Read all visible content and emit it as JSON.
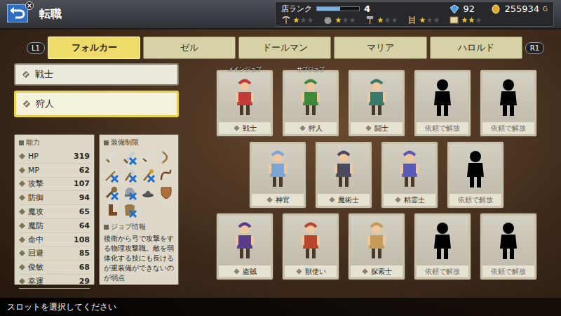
{
  "header": {
    "title": "転職",
    "shop_rank_label": "店ランク",
    "shop_rank": "4",
    "rank_level": 0.55,
    "gems": "92",
    "gold": "255934",
    "gold_unit": "G",
    "max_stars": 3,
    "crafts": [
      {
        "kind": "pickaxe",
        "stars": 1
      },
      {
        "kind": "pot",
        "stars": 1
      },
      {
        "kind": "hammer",
        "stars": 1
      },
      {
        "kind": "ladder",
        "stars": 1
      },
      {
        "kind": "map",
        "stars": 2
      }
    ]
  },
  "shoulder_left": "L1",
  "shoulder_right": "R1",
  "tabs": [
    {
      "label": "フォルカー",
      "selected": true
    },
    {
      "label": "ゼル",
      "selected": false
    },
    {
      "label": "ドールマン",
      "selected": false
    },
    {
      "label": "マリア",
      "selected": false
    },
    {
      "label": "ハロルド",
      "selected": false
    }
  ],
  "slots": [
    {
      "label": "戦士",
      "selected": false
    },
    {
      "label": "狩人",
      "selected": true
    }
  ],
  "stats": {
    "title": "能力",
    "rows": [
      {
        "label": "HP",
        "value": "319"
      },
      {
        "label": "MP",
        "value": "62"
      },
      {
        "label": "攻撃",
        "value": "107"
      },
      {
        "label": "防御",
        "value": "94"
      },
      {
        "label": "魔攻",
        "value": "65"
      },
      {
        "label": "魔防",
        "value": "64"
      },
      {
        "label": "命中",
        "value": "108"
      },
      {
        "label": "回避",
        "value": "85"
      },
      {
        "label": "俊敏",
        "value": "68"
      },
      {
        "label": "幸運",
        "value": "29"
      }
    ]
  },
  "equipment": {
    "title": "装備制限",
    "items": [
      {
        "kind": "sword",
        "restricted": false
      },
      {
        "kind": "greatsword",
        "restricted": true
      },
      {
        "kind": "dagger",
        "restricted": false
      },
      {
        "kind": "bow",
        "restricted": false
      },
      {
        "kind": "spear",
        "restricted": true
      },
      {
        "kind": "axe",
        "restricted": true
      },
      {
        "kind": "staff",
        "restricted": true
      },
      {
        "kind": "whip",
        "restricted": false
      },
      {
        "kind": "club",
        "restricted": true
      },
      {
        "kind": "helmet",
        "restricted": true
      },
      {
        "kind": "hat",
        "restricted": false
      },
      {
        "kind": "shield",
        "restricted": false
      },
      {
        "kind": "boots",
        "restricted": false
      },
      {
        "kind": "armor",
        "restricted": true
      }
    ]
  },
  "job_info": {
    "title": "ジョブ情報",
    "text": "後衛から弓で攻撃をする物理攻撃職。敵を弱体化する技にも長けるが重装備ができないのが弱点"
  },
  "job_rows": [
    {
      "cards": [
        {
          "label": "戦士",
          "badge": "メインジョブ",
          "locked": false,
          "color": "#c23b3b"
        },
        {
          "label": "狩人",
          "badge": "サブジョブ",
          "locked": false,
          "color": "#3f8a3a"
        },
        {
          "label": "闘士",
          "badge": "",
          "locked": false,
          "color": "#3a7a6a"
        },
        {
          "label": "依頼で解放",
          "badge": "",
          "locked": true
        },
        {
          "label": "依頼で解放",
          "badge": "",
          "locked": true
        }
      ]
    },
    {
      "cards": [
        {
          "label": "神官",
          "badge": "",
          "locked": false,
          "color": "#7aa6d6"
        },
        {
          "label": "魔術士",
          "badge": "",
          "locked": false,
          "color": "#4a4a5e"
        },
        {
          "label": "精霊士",
          "badge": "",
          "locked": false,
          "color": "#5a5ab8"
        },
        {
          "label": "依頼で解放",
          "badge": "",
          "locked": true
        }
      ]
    },
    {
      "cards": [
        {
          "label": "盗賊",
          "badge": "",
          "locked": false,
          "color": "#5a3d8a"
        },
        {
          "label": "獣使い",
          "badge": "",
          "locked": false,
          "color": "#b8452e"
        },
        {
          "label": "探索士",
          "badge": "",
          "locked": false,
          "color": "#c79a5a"
        },
        {
          "label": "依頼で解放",
          "badge": "",
          "locked": true
        },
        {
          "label": "依頼で解放",
          "badge": "",
          "locked": true
        }
      ]
    }
  ],
  "status_bar": "スロットを選択してください"
}
